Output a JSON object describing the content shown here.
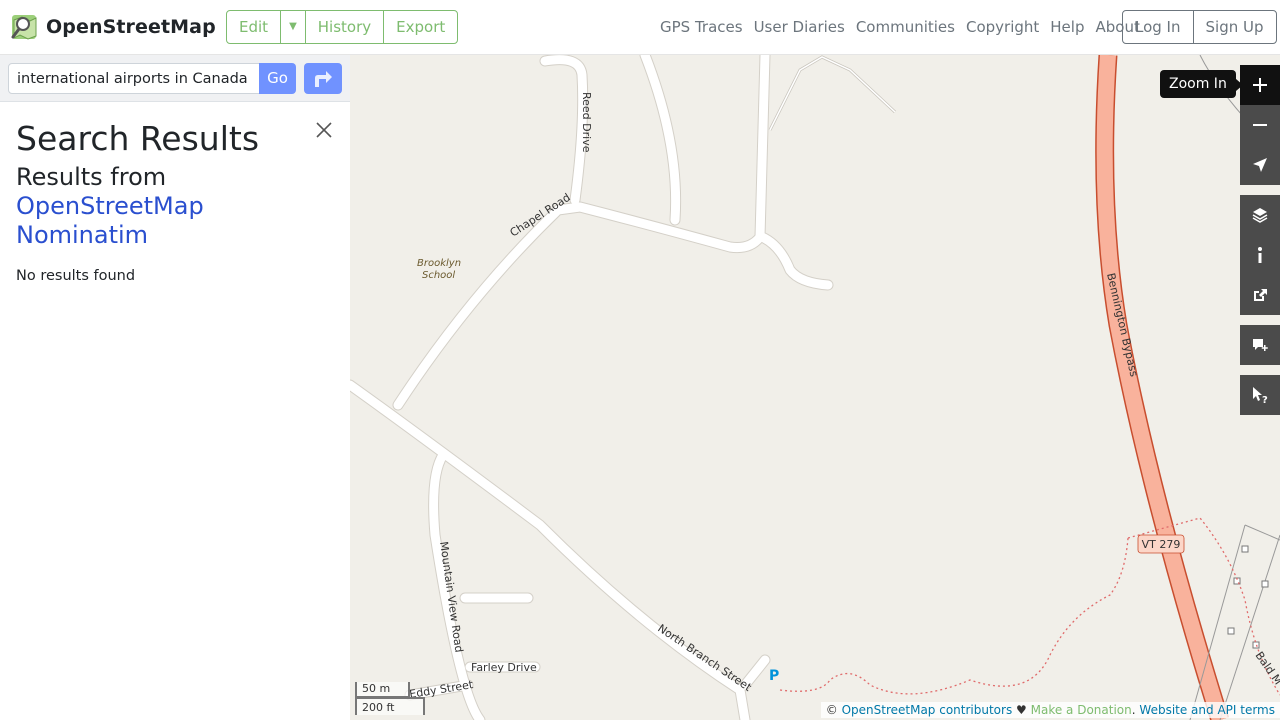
{
  "header": {
    "brand": "OpenStreetMap",
    "edit_group": {
      "edit": "Edit",
      "history": "History",
      "export": "Export"
    },
    "nav": [
      "GPS Traces",
      "User Diaries",
      "Communities",
      "Copyright",
      "Help",
      "About"
    ],
    "auth": {
      "login": "Log In",
      "signup": "Sign Up"
    }
  },
  "sidebar": {
    "search": {
      "value": "international airports in Canada",
      "go": "Go"
    },
    "results": {
      "title": "Search Results",
      "from_label": "Results from",
      "provider": "OpenStreetMap Nominatim",
      "message": "No results found"
    }
  },
  "map": {
    "tooltip": "Zoom In",
    "labels": {
      "reed_drive": "Reed Drive",
      "chapel_road": "Chapel Road",
      "brooklyn_school_1": "Brooklyn",
      "brooklyn_school_2": "School",
      "bennington_bypass": "Bennington Bypass",
      "vt279": "VT 279",
      "mountain_view_road": "Mountain View Road",
      "north_branch_street": "North Branch Street",
      "farley_drive": "Farley Drive",
      "eddy_street": "Eddy Street",
      "bald": "Bald M",
      "parking": "P"
    },
    "scale": {
      "metric": "50 m",
      "imperial": "200 ft"
    },
    "attribution": {
      "copyright": "©",
      "contributors": "OpenStreetMap contributors",
      "heart": "♥",
      "donate": "Make a Donation",
      "sep": ".",
      "terms": "Website and API terms"
    },
    "colors": {
      "background": "#f1efe9",
      "road": "#ffffff",
      "road_casing": "#d4d0c8",
      "trunk": "#f9b29c",
      "trunk_casing": "#c84e2f",
      "boundary": "#e06b6b"
    }
  }
}
